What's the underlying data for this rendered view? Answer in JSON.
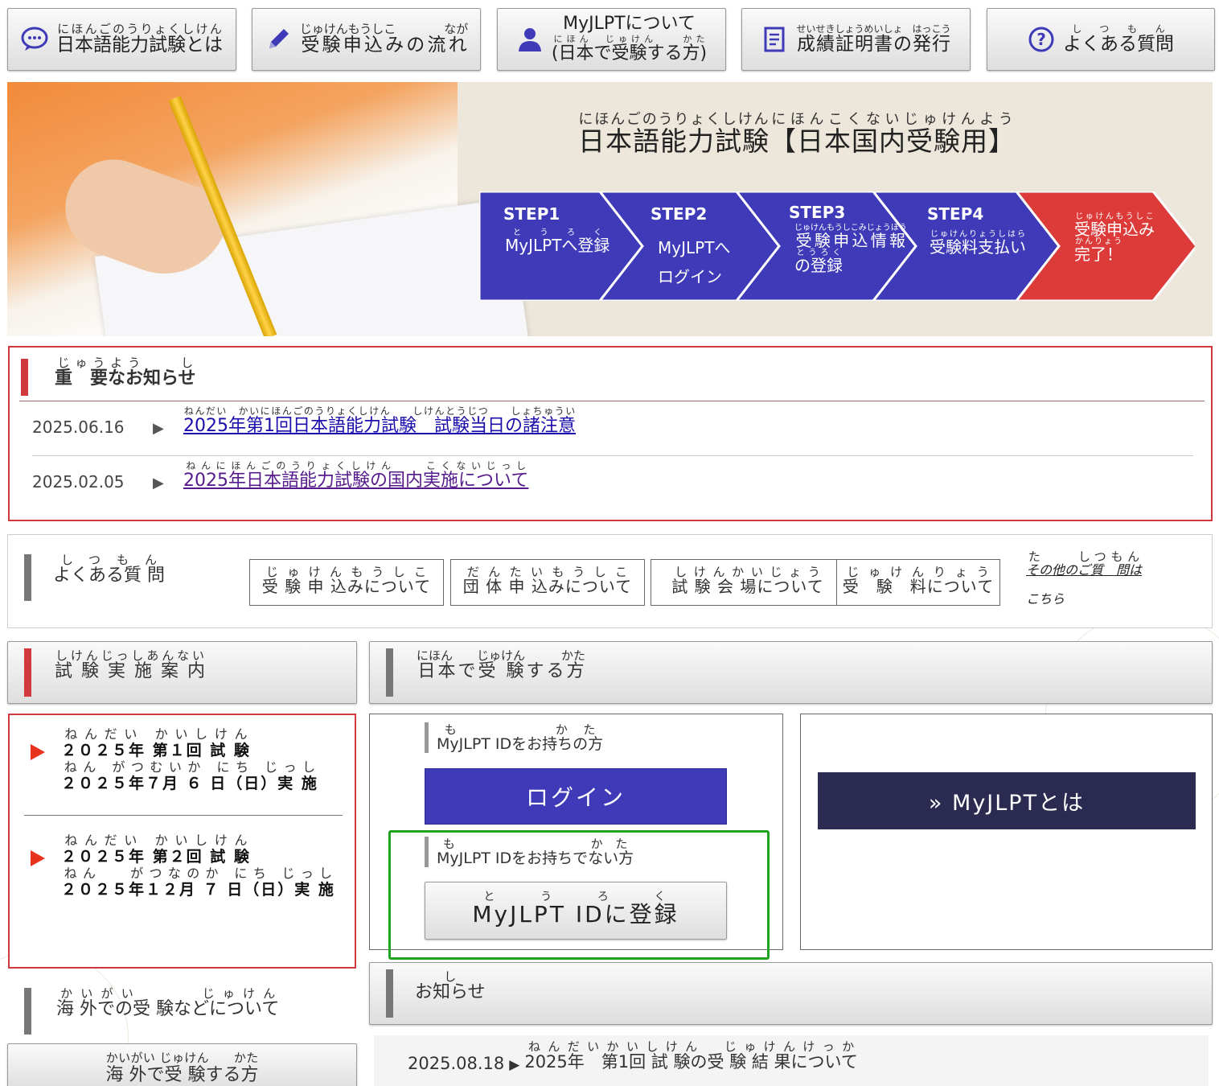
{
  "nav": {
    "about": {
      "ruby": "にほんごのうりょくしけん",
      "label": "日本語能力試験とは"
    },
    "flow": {
      "ruby": "じゅけんもうしこ　　　　なが",
      "label": "受験申込みの流れ"
    },
    "myjlpt_line1": "MyJLPTについて",
    "myjlpt_ruby": "にほん　じゅけん　　かた",
    "myjlpt_line2": "(日本で受験する方)",
    "certificate": {
      "ruby": "せいせきしょうめいしょ　はっこう",
      "label": "成績証明書の発行"
    },
    "faq": {
      "ruby": "しつもん",
      "label": "よくある質問"
    }
  },
  "hero": {
    "title_ruby_1": "にほんごのうりょくしけん",
    "title_1": "日本語能力試験",
    "title_ruby_2": "にほんこくないじゅけんよう",
    "title_2": "【日本国内受験用】",
    "steps": [
      {
        "label": "STEP1",
        "ruby": "とうろく",
        "text": "MyJLPTへ登録"
      },
      {
        "label": "STEP2",
        "text_1": "MyJLPTへ",
        "text_2": "ログイン"
      },
      {
        "label": "STEP3",
        "ruby_1": "じゅけんもうしこみじょうほう",
        "text_1": "受験申込情報",
        "ruby_2": "とうろく",
        "text_2": "の登録"
      },
      {
        "label": "STEP4",
        "ruby": "じゅけんりょうしはら",
        "text": "受験料支払い"
      },
      {
        "ruby_1": "じゅけんもうしこ",
        "text_1": "受験申込み",
        "ruby_2": "かんりょう",
        "text_2": "完了！"
      }
    ]
  },
  "notice": {
    "heading_ruby": "じゅうよう　　し",
    "heading": "重　要なお知らせ",
    "items": [
      {
        "date": "2025.06.16",
        "ruby": "ねんだい　かいにほんごのうりょくしけん　　しけんとうじつ　　しょちゅうい",
        "title": "2025年第1回日本語能力試験　試験当日の諸注意"
      },
      {
        "date": "2025.02.05",
        "ruby": "ねんにほんごのうりょくしけん　　こくないじっし",
        "title": "2025年日本語能力試験の国内実施について"
      }
    ]
  },
  "faq": {
    "heading_ruby": "しつもん",
    "heading": "よくある質 問",
    "categories": [
      {
        "ruby": "じゅけんもうしこ",
        "label": "受 験 申 込みについて"
      },
      {
        "ruby": "だんたいもうしこ",
        "label": "団 体 申 込みについて"
      },
      {
        "ruby": "しけんかいじょう",
        "label": "試 験 会 場について"
      },
      {
        "ruby": "じゅけんりょう",
        "label": "受　験　料について"
      }
    ],
    "other_ruby": "た　　しつもん",
    "other_1": "その他のご質　問は",
    "other_2": "こちら"
  },
  "schedule": {
    "heading_ruby": "しけんじっしあんない",
    "heading": "試 験 実 施 案 内",
    "items": [
      {
        "ruby_1": "ねんだい かいしけん",
        "line_1": "２０２５年 第１回 試 験",
        "ruby_2": "ねん がつむいか にち じっし",
        "line_2": "２０２５年７月 ６ 日（日）実 施"
      },
      {
        "ruby_1": "ねんだい かいしけん",
        "line_1": "２０２５年 第２回 試 験",
        "ruby_2": "ねん　 がつなのか にち じっし",
        "line_2": "２０２５年１２月 ７ 日（日）実 施"
      }
    ]
  },
  "japan": {
    "heading_ruby": "にほん　　じゅけん　　　かた",
    "heading": "日本で受 験する方",
    "has_id_ruby": "も　　　かた",
    "has_id": "MyJLPT IDをお持ちの方",
    "login": "ログイン",
    "no_id_ruby": "も　　　　　かた",
    "no_id": "MyJLPT IDをお持ちでない方",
    "register_ruby": "とうろく",
    "register": "MyJLPT IDに登録",
    "about_myjlpt": "» MyJLPTとは"
  },
  "overseas": {
    "heading_ruby": "かいがい　　　じゅけん",
    "heading": "海 外での受 験などについて",
    "button_ruby": "かいがい じゅけん　　かた",
    "button": "海 外で受 験する方"
  },
  "news": {
    "heading_ruby": "し",
    "heading": "お知らせ",
    "items": [
      {
        "date": "2025.08.18",
        "ruby": "ねんだいかいしけん　じゅけんけっか",
        "title": "2025年　第1回 試 験の受 験 結 果について"
      }
    ]
  },
  "colors": {
    "accent_blue": "#3e3ab8",
    "accent_red": "#d0393e",
    "dark_navy": "#2b2a50",
    "highlight_green": "#22a31e"
  }
}
